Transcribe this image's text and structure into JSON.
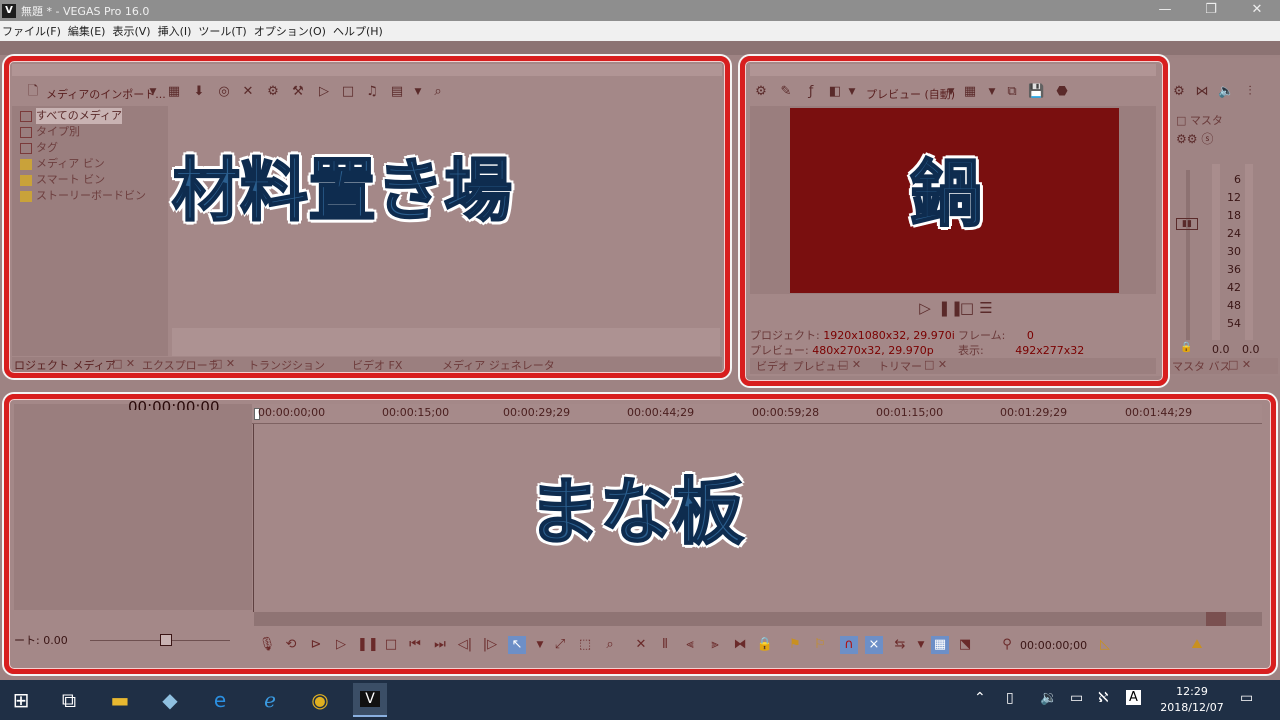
{
  "window": {
    "title": "無題 * - VEGAS Pro 16.0",
    "app_icon": "V"
  },
  "menu": [
    "ファイル(F)",
    "編集(E)",
    "表示(V)",
    "挿入(I)",
    "ツール(T)",
    "オプション(O)",
    "ヘルプ(H)"
  ],
  "media_panel": {
    "import_label": "メディアのインポート...",
    "tree": [
      "すべてのメディア",
      "タイプ別",
      "タグ",
      "メディア ビン",
      "スマート ビン",
      "ストーリーボードビン"
    ],
    "tabs": [
      "ロジェクト メディア",
      "エクスプローラ",
      "トランジション",
      "ビデオ FX",
      "メディア ジェネレータ"
    ],
    "overlay": "材料置き場"
  },
  "preview_panel": {
    "preview_label": "プレビュー (自動)",
    "overlay": "鍋",
    "project_label": "プロジェクト:",
    "project_value": "1920x1080x32, 29.970i",
    "preview_row_label": "プレビュー:",
    "preview_value": "480x270x32, 29.970p",
    "frame_label": "フレーム:",
    "frame_value": "0",
    "display_label": "表示:",
    "display_value": "492x277x32",
    "tabs": [
      "ビデオ プレビュー",
      "トリマー"
    ],
    "screen_color": "#7a0f0f"
  },
  "master_panel": {
    "label": "マスタ",
    "scale": [
      "6",
      "12",
      "18",
      "24",
      "30",
      "36",
      "42",
      "48",
      "54"
    ],
    "left_value": "0.0",
    "right_value": "0.0",
    "tab": "マスタ バス"
  },
  "timeline": {
    "timecode": "00:00:00;00",
    "ruler": [
      "00:00:00;00",
      "00:00:15;00",
      "00:00:29;29",
      "00:00:44;29",
      "00:00:59;28",
      "00:01:15;00",
      "00:01:29;29",
      "00:01:44;29"
    ],
    "rate_label": "ート:",
    "rate_value": "0.00",
    "cursor_time": "00:00:00;00",
    "overlay": "まな板"
  },
  "taskbar": {
    "time": "12:29",
    "date": "2018/12/07"
  },
  "colors": {
    "highlight": "#d81e1e",
    "overlay_text": "#2b5f8f"
  }
}
